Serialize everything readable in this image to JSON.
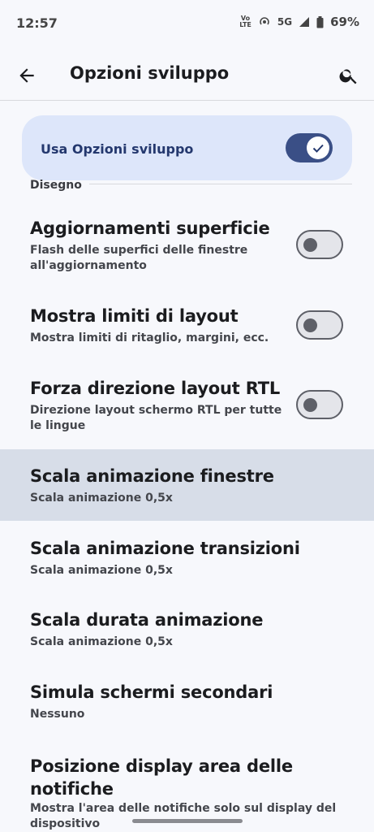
{
  "status": {
    "time": "12:57",
    "volte_line1": "Vo",
    "volte_line2": "LTE",
    "network": "5G",
    "battery": "69%"
  },
  "header": {
    "title": "Opzioni sviluppo"
  },
  "master": {
    "label": "Usa Opzioni sviluppo",
    "checked": true
  },
  "section": {
    "title": "Disegno"
  },
  "rows": [
    {
      "title": "Aggiornamenti superficie",
      "subtitle": "Flash delle superfici delle finestre all'aggiornamento",
      "toggle": false
    },
    {
      "title": "Mostra limiti di layout",
      "subtitle": "Mostra limiti di ritaglio, margini, ecc.",
      "toggle": false
    },
    {
      "title": "Forza direzione layout RTL",
      "subtitle": "Direzione layout schermo RTL per tutte le lingue",
      "toggle": false
    },
    {
      "title": "Scala animazione finestre",
      "subtitle": "Scala animazione 0,5x",
      "highlighted": true
    },
    {
      "title": "Scala animazione transizioni",
      "subtitle": "Scala animazione 0,5x"
    },
    {
      "title": "Scala durata animazione",
      "subtitle": "Scala animazione 0,5x"
    },
    {
      "title": "Simula schermi secondari",
      "subtitle": "Nessuno"
    },
    {
      "title": "Posizione display area delle notifiche",
      "subtitle": "Mostra l'area delle notifiche solo sul display del dispositivo"
    }
  ],
  "colors": {
    "accent": "#3a4f86",
    "card": "#dde6fa",
    "highlight": "#d7dde8"
  }
}
